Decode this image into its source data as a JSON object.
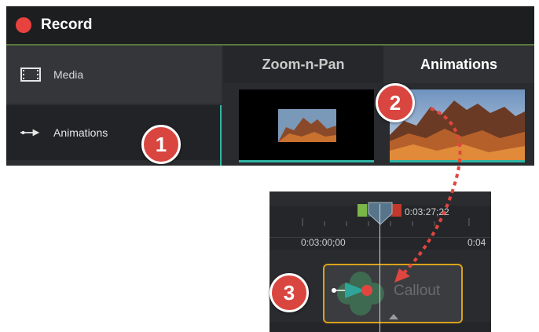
{
  "topbar": {
    "record_label": "Record"
  },
  "sidebar": {
    "items": [
      {
        "label": "Media",
        "icon": "film-icon"
      },
      {
        "label": "Animations",
        "icon": "arrow-icon"
      }
    ]
  },
  "tabs": [
    {
      "label": "Zoom-n-Pan"
    },
    {
      "label": "Animations"
    }
  ],
  "timeline": {
    "playhead_time": "0:03:27;22",
    "tick_1": "0:03:00;00",
    "tick_2": "0:04",
    "clip_label": "Callout"
  },
  "badges": [
    "1",
    "2",
    "3"
  ],
  "colors": {
    "record_red": "#e8423f",
    "accent_teal": "#2fb5a5",
    "clip_border": "#d9a21b",
    "badge_red": "#d9453f",
    "arrow_red": "#e0463f"
  }
}
